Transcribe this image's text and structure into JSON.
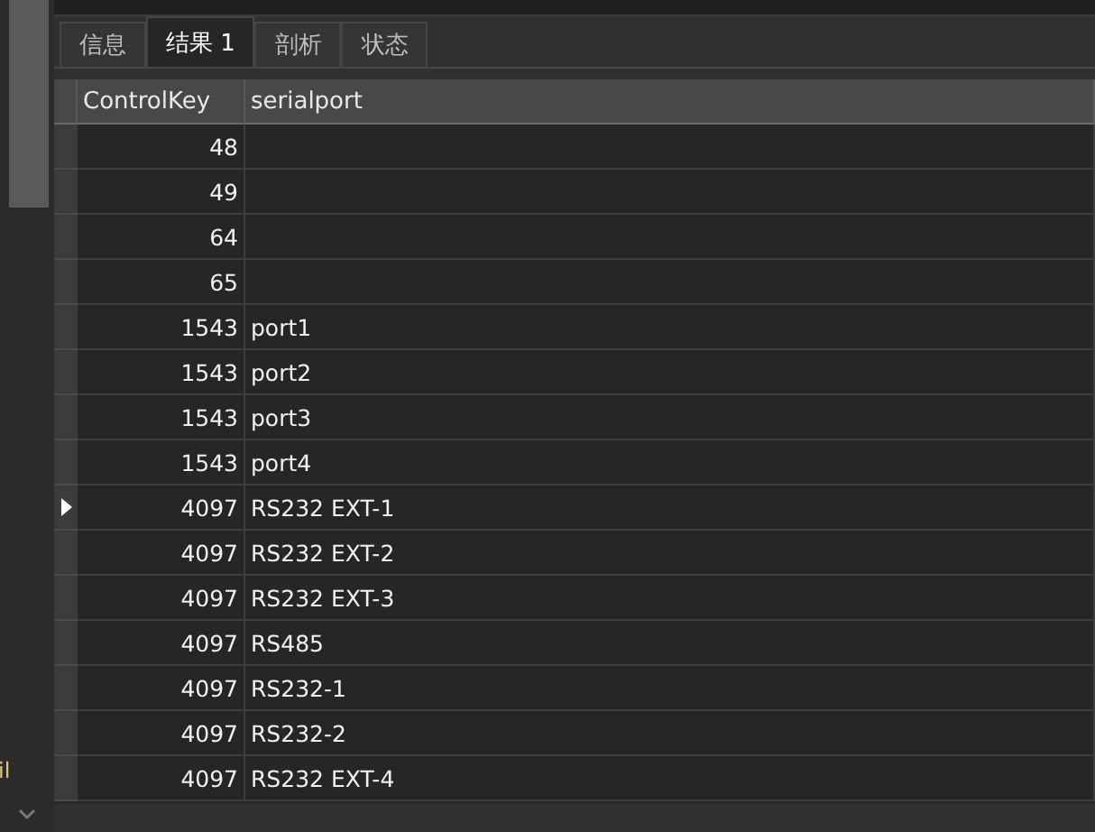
{
  "side_panel": {
    "fragment": "il"
  },
  "tabs": [
    {
      "label": "信息",
      "selected": false
    },
    {
      "label": "结果 1",
      "selected": true
    },
    {
      "label": "剖析",
      "selected": false
    },
    {
      "label": "状态",
      "selected": false
    }
  ],
  "table": {
    "columns": [
      "ControlKey",
      "serialport"
    ],
    "rows": [
      {
        "cells": [
          "48",
          ""
        ],
        "current": false
      },
      {
        "cells": [
          "49",
          ""
        ],
        "current": false
      },
      {
        "cells": [
          "64",
          ""
        ],
        "current": false
      },
      {
        "cells": [
          "65",
          ""
        ],
        "current": false
      },
      {
        "cells": [
          "1543",
          "port1"
        ],
        "current": false
      },
      {
        "cells": [
          "1543",
          "port2"
        ],
        "current": false
      },
      {
        "cells": [
          "1543",
          "port3"
        ],
        "current": false
      },
      {
        "cells": [
          "1543",
          "port4"
        ],
        "current": false
      },
      {
        "cells": [
          "4097",
          "RS232 EXT-1"
        ],
        "current": true
      },
      {
        "cells": [
          "4097",
          "RS232 EXT-2"
        ],
        "current": false
      },
      {
        "cells": [
          "4097",
          "RS232 EXT-3"
        ],
        "current": false
      },
      {
        "cells": [
          "4097",
          "RS485"
        ],
        "current": false
      },
      {
        "cells": [
          "4097",
          "RS232-1"
        ],
        "current": false
      },
      {
        "cells": [
          "4097",
          "RS232-2"
        ],
        "current": false
      },
      {
        "cells": [
          "4097",
          "RS232 EXT-4"
        ],
        "current": false
      }
    ]
  }
}
